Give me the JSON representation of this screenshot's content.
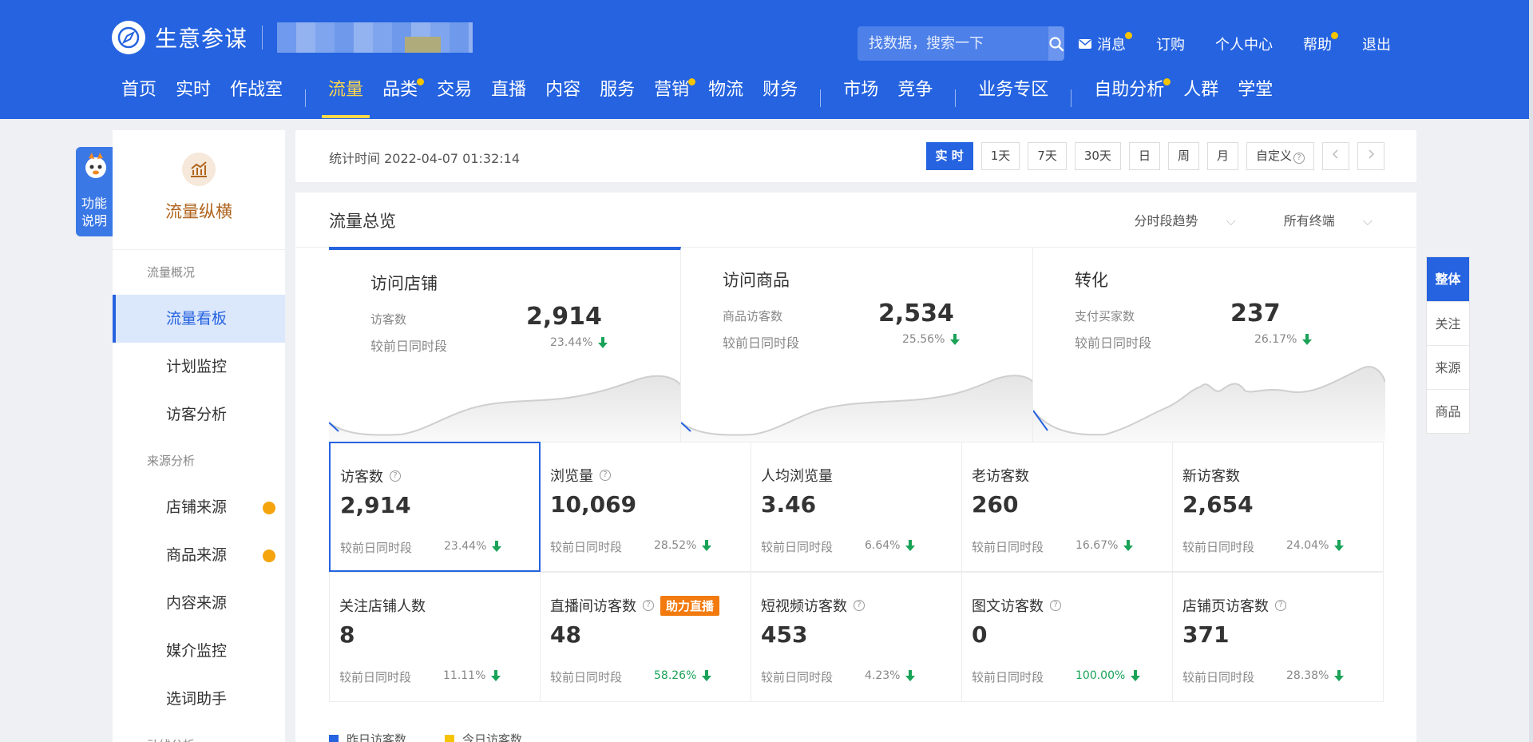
{
  "brand": {
    "name": "生意参谋"
  },
  "search": {
    "placeholder": "找数据，搜索一下"
  },
  "top_links": [
    {
      "label": "消息",
      "dot": true
    },
    {
      "label": "订购",
      "dot": false
    },
    {
      "label": "个人中心",
      "dot": false
    },
    {
      "label": "帮助",
      "dot": true
    },
    {
      "label": "退出",
      "dot": false
    }
  ],
  "nav": {
    "g1": [
      "首页",
      "实时",
      "作战室"
    ],
    "g2": [
      "流量",
      "品类",
      "交易",
      "直播",
      "内容",
      "服务",
      "营销",
      "物流",
      "财务"
    ],
    "g3": [
      "市场",
      "竞争"
    ],
    "g4": [
      "业务专区"
    ],
    "g5": [
      "自助分析",
      "人群",
      "学堂"
    ]
  },
  "func_tag": {
    "line1": "功能",
    "line2": "说明"
  },
  "sidebar": {
    "title": "流量纵横",
    "group1": "流量概况",
    "items1": [
      "流量看板",
      "计划监控",
      "访客分析"
    ],
    "group2": "来源分析",
    "items2": [
      "店铺来源",
      "商品来源",
      "内容来源",
      "媒介监控",
      "选词助手"
    ],
    "group3": "动线分析"
  },
  "timebar": {
    "stat_time": "统计时间 2022-04-07 01:32:14",
    "buttons": [
      "实 时",
      "1天",
      "7天",
      "30天",
      "日",
      "周",
      "月",
      "自定义"
    ]
  },
  "panel": {
    "title": "流量总览",
    "option1": "分时段趋势",
    "option2": "所有终端"
  },
  "colors": {
    "accent": "#2563e0",
    "up_down": "#1aa358",
    "warning": "#f27a0e"
  },
  "overview_cards": [
    {
      "title": "访问店铺",
      "label": "访客数",
      "value": "2,914",
      "cmp": "较前日同时段",
      "pct": "23.44%"
    },
    {
      "title": "访问商品",
      "label": "商品访客数",
      "value": "2,534",
      "cmp": "较前日同时段",
      "pct": "25.56%"
    },
    {
      "title": "转化",
      "label": "支付买家数",
      "value": "237",
      "cmp": "较前日同时段",
      "pct": "26.17%"
    }
  ],
  "metrics": [
    {
      "label": "访客数",
      "help": true,
      "value": "2,914",
      "cmp": "较前日同时段",
      "pct": "23.44%",
      "green": false
    },
    {
      "label": "浏览量",
      "help": true,
      "value": "10,069",
      "cmp": "较前日同时段",
      "pct": "28.52%",
      "green": false
    },
    {
      "label": "人均浏览量",
      "help": false,
      "value": "3.46",
      "cmp": "较前日同时段",
      "pct": "6.64%",
      "green": false
    },
    {
      "label": "老访客数",
      "help": false,
      "value": "260",
      "cmp": "较前日同时段",
      "pct": "16.67%",
      "green": false
    },
    {
      "label": "新访客数",
      "help": false,
      "value": "2,654",
      "cmp": "较前日同时段",
      "pct": "24.04%",
      "green": false
    },
    {
      "label": "关注店铺人数",
      "help": false,
      "value": "8",
      "cmp": "较前日同时段",
      "pct": "11.11%",
      "green": false
    },
    {
      "label": "直播间访客数",
      "help": true,
      "tag": "助力直播",
      "value": "48",
      "cmp": "较前日同时段",
      "pct": "58.26%",
      "green": true
    },
    {
      "label": "短视频访客数",
      "help": true,
      "value": "453",
      "cmp": "较前日同时段",
      "pct": "4.23%",
      "green": false
    },
    {
      "label": "图文访客数",
      "help": true,
      "value": "0",
      "cmp": "较前日同时段",
      "pct": "100.00%",
      "green": true
    },
    {
      "label": "店铺页访客数",
      "help": true,
      "value": "371",
      "cmp": "较前日同时段",
      "pct": "28.38%",
      "green": false
    }
  ],
  "legend": {
    "yesterday": "昨日访客数",
    "today": "今日访客数"
  },
  "right_tabs": [
    "整体",
    "关注",
    "来源",
    "商品"
  ]
}
